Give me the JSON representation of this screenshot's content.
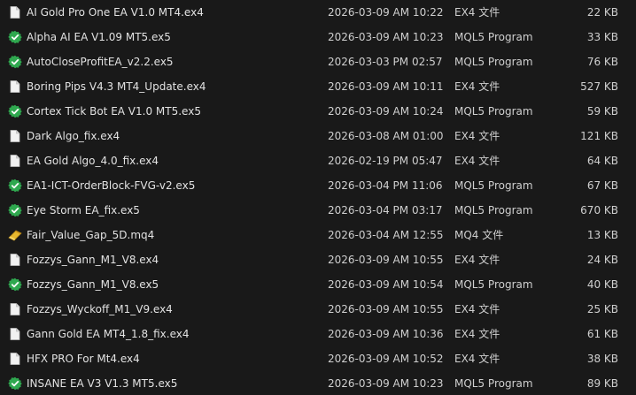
{
  "files": [
    {
      "name": "AI Gold Pro One EA V1.0 MT4.ex4",
      "date": "2026-03-09 AM 10:22",
      "type": "EX4 文件",
      "size": "22 KB",
      "icon": "document-icon"
    },
    {
      "name": "Alpha AI EA V1.09 MT5.ex5",
      "date": "2026-03-09 AM 10:23",
      "type": "MQL5 Program",
      "size": "33 KB",
      "icon": "mql5-program-icon"
    },
    {
      "name": "AutoCloseProfitEA_v2.2.ex5",
      "date": "2026-03-03 PM 02:57",
      "type": "MQL5 Program",
      "size": "76 KB",
      "icon": "mql5-program-icon"
    },
    {
      "name": "Boring Pips V4.3 MT4_Update.ex4",
      "date": "2026-03-09 AM 10:11",
      "type": "EX4 文件",
      "size": "527 KB",
      "icon": "document-icon"
    },
    {
      "name": "Cortex Tick Bot EA V1.0 MT5.ex5",
      "date": "2026-03-09 AM 10:24",
      "type": "MQL5 Program",
      "size": "59 KB",
      "icon": "mql5-program-icon"
    },
    {
      "name": "Dark Algo_fix.ex4",
      "date": "2026-03-08 AM 01:00",
      "type": "EX4 文件",
      "size": "121 KB",
      "icon": "document-icon"
    },
    {
      "name": "EA Gold Algo_4.0_fix.ex4",
      "date": "2026-02-19 PM 05:47",
      "type": "EX4 文件",
      "size": "64 KB",
      "icon": "document-icon"
    },
    {
      "name": "EA1-ICT-OrderBlock-FVG-v2.ex5",
      "date": "2026-03-04 PM 11:06",
      "type": "MQL5 Program",
      "size": "67 KB",
      "icon": "mql5-program-icon"
    },
    {
      "name": "Eye Storm EA_fix.ex5",
      "date": "2026-03-04 PM 03:17",
      "type": "MQL5 Program",
      "size": "670 KB",
      "icon": "mql5-program-icon"
    },
    {
      "name": "Fair_Value_Gap_5D.mq4",
      "date": "2026-03-04 AM 12:55",
      "type": "MQ4 文件",
      "size": "13 KB",
      "icon": "mq4-source-icon"
    },
    {
      "name": "Fozzys_Gann_M1_V8.ex4",
      "date": "2026-03-09 AM 10:55",
      "type": "EX4 文件",
      "size": "24 KB",
      "icon": "document-icon"
    },
    {
      "name": "Fozzys_Gann_M1_V8.ex5",
      "date": "2026-03-09 AM 10:54",
      "type": "MQL5 Program",
      "size": "40 KB",
      "icon": "mql5-program-icon"
    },
    {
      "name": "Fozzys_Wyckoff_M1_V9.ex4",
      "date": "2026-03-09 AM 10:55",
      "type": "EX4 文件",
      "size": "25 KB",
      "icon": "document-icon"
    },
    {
      "name": "Gann Gold EA MT4_1.8_fix.ex4",
      "date": "2026-03-09 AM 10:36",
      "type": "EX4 文件",
      "size": "61 KB",
      "icon": "document-icon"
    },
    {
      "name": "HFX PRO For Mt4.ex4",
      "date": "2026-03-09 AM 10:52",
      "type": "EX4 文件",
      "size": "38 KB",
      "icon": "document-icon"
    },
    {
      "name": "INSANE EA V3 V1.3 MT5.ex5",
      "date": "2026-03-09 AM 10:23",
      "type": "MQL5 Program",
      "size": "89 KB",
      "icon": "mql5-program-icon"
    }
  ],
  "colors": {
    "background": "#191919",
    "text": "#d9d9d9",
    "mql5_green": "#2fa84f",
    "mq4_yellow": "#e8b82e"
  }
}
